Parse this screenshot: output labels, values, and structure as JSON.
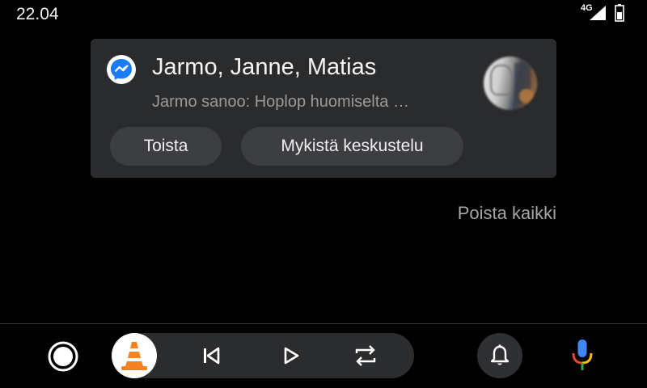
{
  "status_bar": {
    "time": "22.04",
    "network_type": "4G",
    "signal_icon": "cell-signal-icon",
    "battery_icon": "battery-icon"
  },
  "notification": {
    "app_icon": "messenger-icon",
    "title": "Jarmo, Janne, Matias",
    "preview": "Jarmo sanoo: Hoplop huomiselta …",
    "avatar": "group-avatar",
    "actions": {
      "reply_label": "Toista",
      "mute_label": "Mykistä keskustelu"
    },
    "colors": {
      "card_bg": "#2a2b2d",
      "button_bg": "#3c3e41",
      "messenger_blue": "#1a7cf5"
    }
  },
  "clear_all_label": "Poista kaikki",
  "nav_bar": {
    "home_icon": "home-circle-icon",
    "media": {
      "app_icon": "vlc-cone-icon",
      "prev_icon": "skip-previous-icon",
      "play_icon": "play-icon",
      "repeat_icon": "repeat-icon"
    },
    "notifications_icon": "bell-icon",
    "assistant_icon": "microphone-icon",
    "colors": {
      "vlc_orange": "#f58220",
      "mic_blue": "#4285f4",
      "mic_red": "#ea4335",
      "mic_yellow": "#fbbc05",
      "mic_green": "#34a853"
    }
  }
}
